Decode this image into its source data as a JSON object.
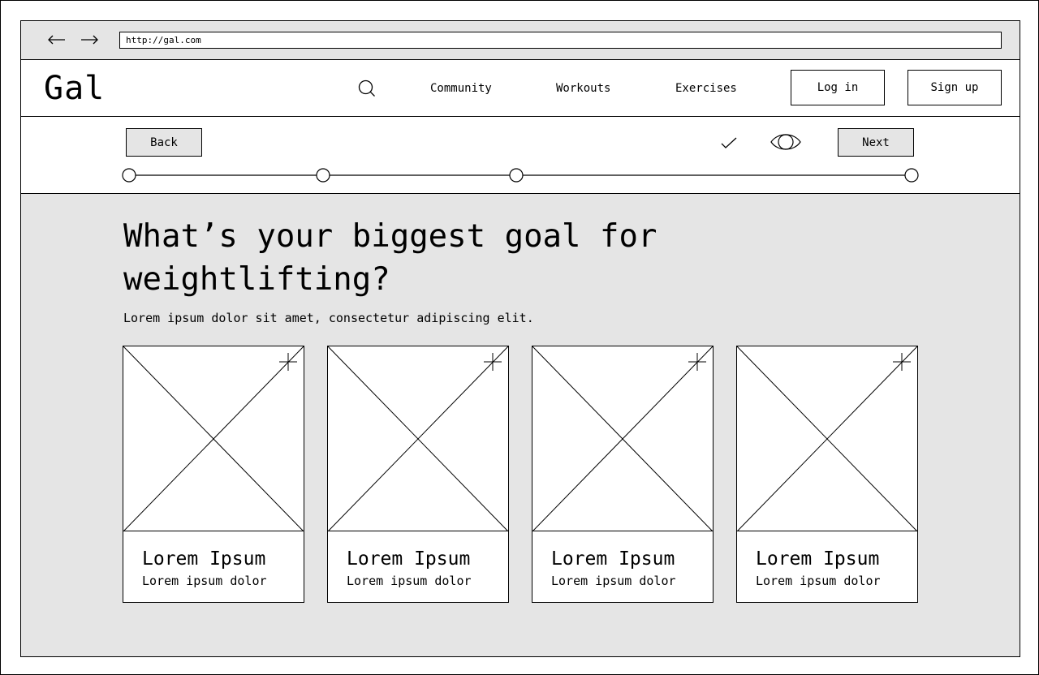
{
  "browser": {
    "url": "http://gal.com",
    "back_icon": "arrow-left-icon",
    "forward_icon": "arrow-right-icon"
  },
  "header": {
    "logo": "Gal",
    "search_icon": "search-icon",
    "nav": [
      "Community",
      "Workouts",
      "Exercises"
    ],
    "login_label": "Log in",
    "signup_label": "Sign up"
  },
  "steps": {
    "back_label": "Back",
    "next_label": "Next",
    "check_icon": "check-icon",
    "preview_icon": "eye-icon",
    "step_count": 4
  },
  "main": {
    "title": "What’s your biggest goal for weightlifting?",
    "subtitle": "Lorem ipsum dolor sit amet, consectetur adipiscing elit.",
    "cards": [
      {
        "title": "Lorem Ipsum",
        "description": "Lorem ipsum dolor"
      },
      {
        "title": "Lorem Ipsum",
        "description": "Lorem ipsum dolor"
      },
      {
        "title": "Lorem Ipsum",
        "description": "Lorem ipsum dolor"
      },
      {
        "title": "Lorem Ipsum",
        "description": "Lorem ipsum dolor"
      }
    ]
  },
  "colors": {
    "background_grey": "#e5e5e5",
    "line": "#000000",
    "surface": "#ffffff"
  }
}
